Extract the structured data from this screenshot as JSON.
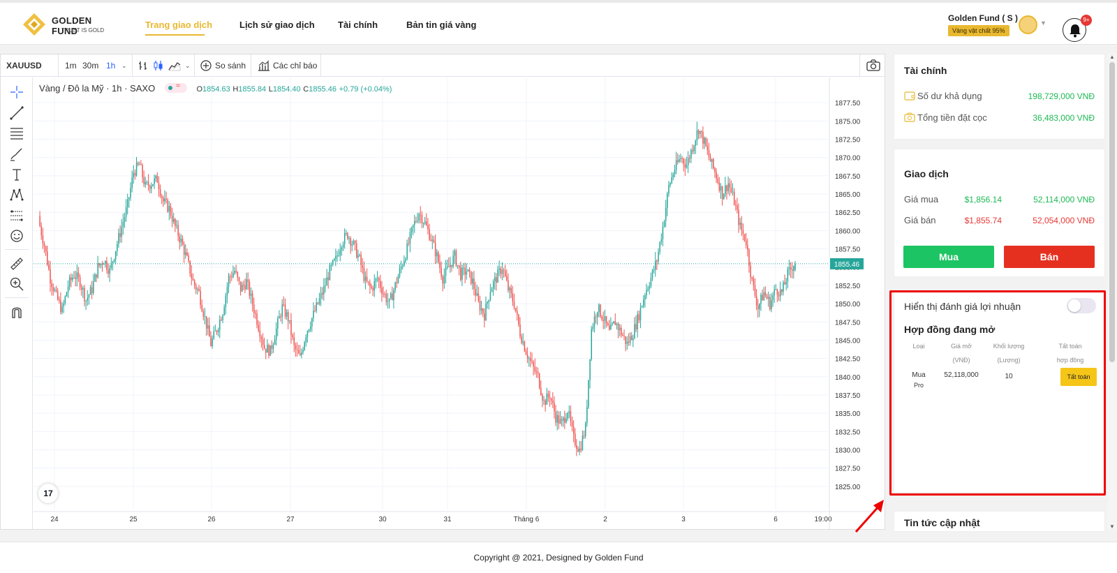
{
  "header": {
    "logo_name": "GOLDEN FUND",
    "logo_tagline": "TRUST IS GOLD",
    "nav": [
      {
        "label": "Trang giao dịch",
        "active": true
      },
      {
        "label": "Lịch sử giao dịch",
        "active": false
      },
      {
        "label": "Tài chính",
        "active": false
      },
      {
        "label": "Bản tin giá vàng",
        "active": false
      }
    ],
    "account_name": "Golden Fund ( S )",
    "account_badge": "Vàng vật chất 95%",
    "notification_count": "9+"
  },
  "toolbar": {
    "symbol": "XAUUSD",
    "intervals": [
      "1m",
      "30m",
      "1h"
    ],
    "compare_label": "So sánh",
    "indicators_label": "Các chỉ báo"
  },
  "chart": {
    "legend_title": "Vàng / Đô la Mỹ · 1h · SAXO",
    "open_label": "O",
    "open": "1854.63",
    "high_label": "H",
    "high": "1855.84",
    "low_label": "L",
    "low": "1854.40",
    "close_label": "C",
    "close": "1855.46",
    "change": "+0.79 (+0.04%)",
    "last_price": "1855.46",
    "brand_mark": "17"
  },
  "chart_data": {
    "type": "candlestick",
    "title": "Vàng / Đô la Mỹ · 1h · SAXO",
    "ylim": [
      1825,
      1880
    ],
    "y_ticks": [
      "1877.50",
      "1875.00",
      "1872.50",
      "1870.00",
      "1867.50",
      "1865.00",
      "1862.50",
      "1860.00",
      "1857.50",
      "1855.00",
      "1852.50",
      "1850.00",
      "1847.50",
      "1845.00",
      "1842.50",
      "1840.00",
      "1837.50",
      "1835.00",
      "1832.50",
      "1830.00",
      "1827.50",
      "1825.00"
    ],
    "x_ticks": [
      "24",
      "25",
      "26",
      "27",
      "30",
      "31",
      "Tháng 6",
      "2",
      "3",
      "6",
      "19:00"
    ],
    "close_path": [
      1861.5,
      1858.0,
      1853.5,
      1851.0,
      1849.0,
      1852.5,
      1854.0,
      1853.0,
      1850.5,
      1852.0,
      1855.0,
      1856.0,
      1854.5,
      1857.5,
      1860.5,
      1863.5,
      1868.0,
      1869.0,
      1866.0,
      1866.5,
      1867.0,
      1864.0,
      1863.0,
      1860.5,
      1858.5,
      1856.0,
      1853.0,
      1851.5,
      1848.0,
      1844.5,
      1846.5,
      1849.0,
      1853.5,
      1854.5,
      1852.0,
      1853.0,
      1850.0,
      1847.0,
      1844.0,
      1843.5,
      1846.5,
      1849.5,
      1848.0,
      1844.0,
      1842.5,
      1846.0,
      1848.0,
      1850.0,
      1852.0,
      1854.5,
      1856.0,
      1858.5,
      1859.5,
      1858.0,
      1856.0,
      1853.0,
      1852.0,
      1853.5,
      1851.5,
      1850.0,
      1852.5,
      1855.0,
      1857.5,
      1860.5,
      1862.5,
      1861.0,
      1859.0,
      1856.5,
      1853.5,
      1855.0,
      1856.5,
      1854.0,
      1854.5,
      1853.0,
      1850.0,
      1848.5,
      1852.0,
      1853.5,
      1855.0,
      1852.0,
      1850.0,
      1846.0,
      1843.5,
      1841.5,
      1840.0,
      1836.5,
      1837.5,
      1834.5,
      1833.5,
      1835.5,
      1831.5,
      1830.0,
      1833.0,
      1846.5,
      1849.5,
      1848.0,
      1846.0,
      1847.5,
      1846.0,
      1844.5,
      1846.0,
      1848.5,
      1851.5,
      1853.5,
      1856.0,
      1860.5,
      1866.0,
      1868.5,
      1870.0,
      1869.0,
      1871.5,
      1874.0,
      1872.0,
      1869.5,
      1867.5,
      1865.0,
      1866.5,
      1864.0,
      1860.5,
      1858.5,
      1853.0,
      1849.5,
      1851.5,
      1850.0,
      1852.0,
      1851.5,
      1854.0,
      1855.46
    ],
    "series_colors": {
      "up": "#26a69a",
      "down": "#ef5350"
    }
  },
  "finance": {
    "title": "Tài chính",
    "balance_label": "Số dư khả dụng",
    "balance_value": "198,729,000  VNĐ",
    "deposit_label": "Tổng tiền đặt cọc",
    "deposit_value": "36,483,000  VNĐ"
  },
  "trade": {
    "title": "Giao dịch",
    "buy_label": "Giá mua",
    "buy_usd": "$1,856.14",
    "buy_vnd": "52,114,000  VNĐ",
    "sell_label": "Giá bán",
    "sell_usd": "$1,855.74",
    "sell_vnd": "52,054,000  VNĐ",
    "buy_button": "Mua",
    "sell_button": "Bán"
  },
  "contracts": {
    "toggle_label": "Hiển thị đánh giá lợi nhuận",
    "toggle_on": false,
    "title": "Hợp đồng đang mở",
    "col_type": "Loại",
    "col_price": "Giá mở",
    "col_price_unit": "(VNĐ)",
    "col_qty": "Khối lượng",
    "col_qty_unit": "(Lượng)",
    "col_close": "Tất toán",
    "col_close_2": "hợp đồng",
    "rows": [
      {
        "type": "Mua",
        "sub": "Pro",
        "price": "52,118,000",
        "qty": "10",
        "action": "Tất toán"
      }
    ]
  },
  "news": {
    "title": "Tin tức cập nhật"
  },
  "footer": {
    "copyright": "Copyright @ 2021, Designed by Golden Fund"
  },
  "colors": {
    "accent": "#e8b830",
    "buy": "#1db954",
    "sell": "#e53935",
    "highlight": "#ee0000"
  }
}
